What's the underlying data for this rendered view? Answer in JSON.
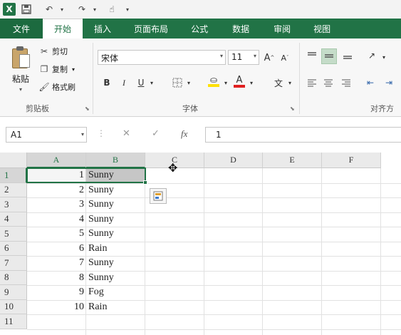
{
  "quick_access": {
    "save_icon": "save-icon",
    "undo_icon": "undo-icon",
    "redo_icon": "redo-icon",
    "customize_icon": "customize-icon"
  },
  "tabs": [
    {
      "label": "文件"
    },
    {
      "label": "开始"
    },
    {
      "label": "插入"
    },
    {
      "label": "页面布局"
    },
    {
      "label": "公式"
    },
    {
      "label": "数据"
    },
    {
      "label": "审阅"
    },
    {
      "label": "视图"
    }
  ],
  "clipboard": {
    "paste_label": "粘贴",
    "cut_label": "剪切",
    "copy_label": "复制",
    "format_painter_label": "格式刷",
    "group_label": "剪贴板"
  },
  "font": {
    "family": "宋体",
    "size": "11",
    "increase_label": "A",
    "decrease_label": "A",
    "bold_label": "B",
    "italic_label": "I",
    "underline_label": "U",
    "font_color_label": "A",
    "phonetic_label": "文",
    "group_label": "字体",
    "font_color": "#e02020",
    "fill_color": "#ffe000"
  },
  "alignment": {
    "group_label": "对齐方"
  },
  "formula_bar": {
    "name_box": "A1",
    "cancel_label": "✕",
    "enter_label": "✓",
    "fx_label": "fx",
    "value": "1"
  },
  "sheet": {
    "columns": [
      "A",
      "B",
      "C",
      "D",
      "E",
      "F"
    ],
    "row_numbers": [
      "1",
      "2",
      "3",
      "4",
      "5",
      "6",
      "7",
      "8",
      "9",
      "10",
      "11"
    ],
    "rows": [
      {
        "a": "1",
        "b": "Sunny"
      },
      {
        "a": "2",
        "b": "Sunny"
      },
      {
        "a": "3",
        "b": "Sunny"
      },
      {
        "a": "4",
        "b": "Sunny"
      },
      {
        "a": "5",
        "b": "Sunny"
      },
      {
        "a": "6",
        "b": "Rain"
      },
      {
        "a": "7",
        "b": "Sunny"
      },
      {
        "a": "8",
        "b": "Sunny"
      },
      {
        "a": "9",
        "b": "Fog"
      },
      {
        "a": "10",
        "b": "Rain"
      }
    ],
    "accent_color": "#217346"
  }
}
